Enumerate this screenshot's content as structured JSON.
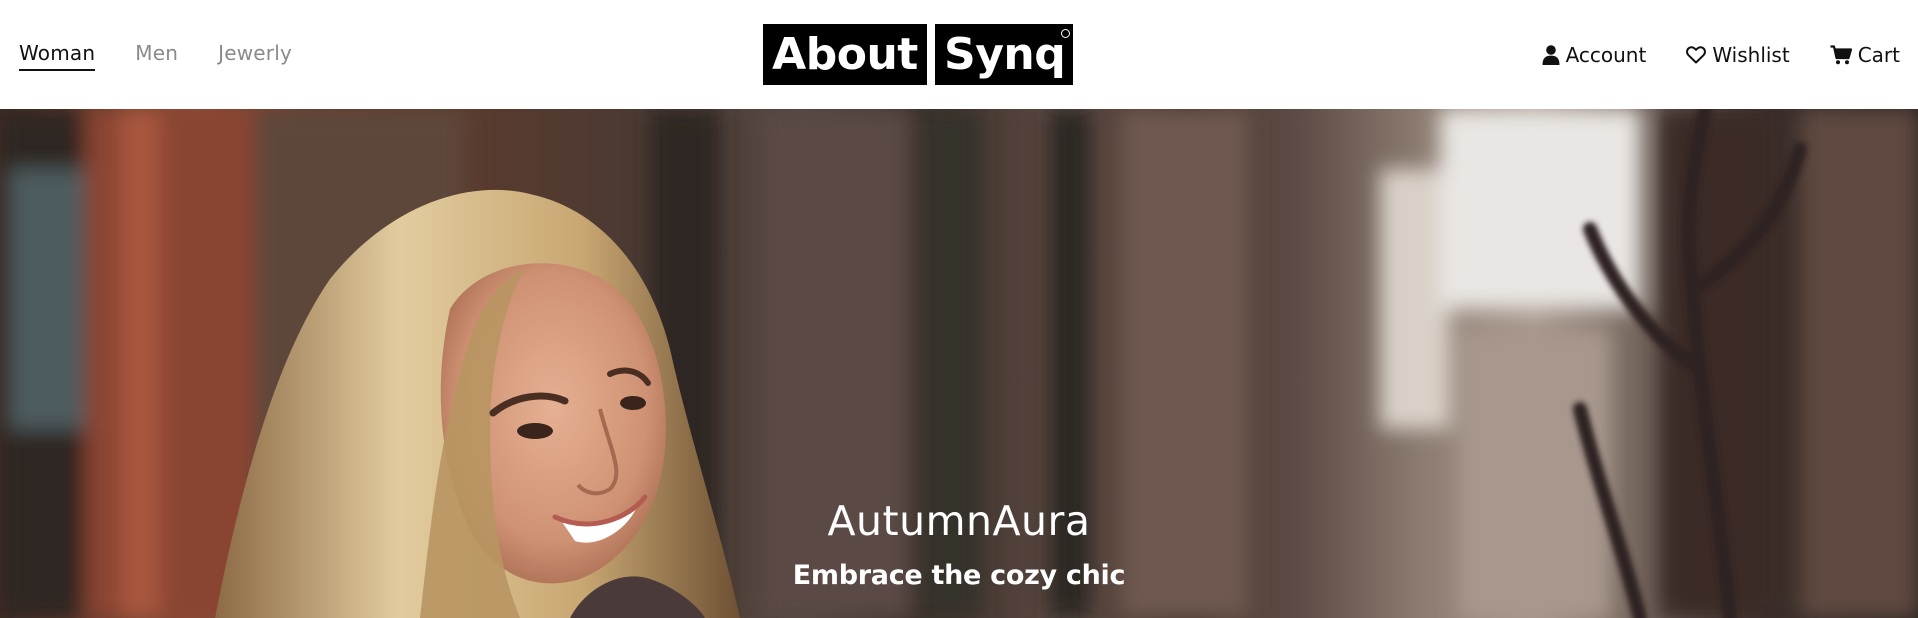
{
  "header": {
    "nav_left": [
      {
        "label": "Woman",
        "active": true
      },
      {
        "label": "Men",
        "active": false
      },
      {
        "label": "Jewerly",
        "active": false
      }
    ],
    "logo": {
      "part1": "About",
      "part2": "Synq"
    },
    "nav_right": {
      "account": {
        "label": "Account",
        "icon": "user-icon"
      },
      "wishlist": {
        "label": "Wishlist",
        "icon": "heart-icon"
      },
      "cart": {
        "label": "Cart",
        "icon": "cart-icon"
      }
    }
  },
  "hero": {
    "title": "AutumnAura",
    "subtitle": "Embrace the cozy chic"
  },
  "colors": {
    "text": "#111111",
    "muted": "#8a8a8a",
    "logo_bg": "#000000",
    "hero_text": "#ffffff"
  }
}
